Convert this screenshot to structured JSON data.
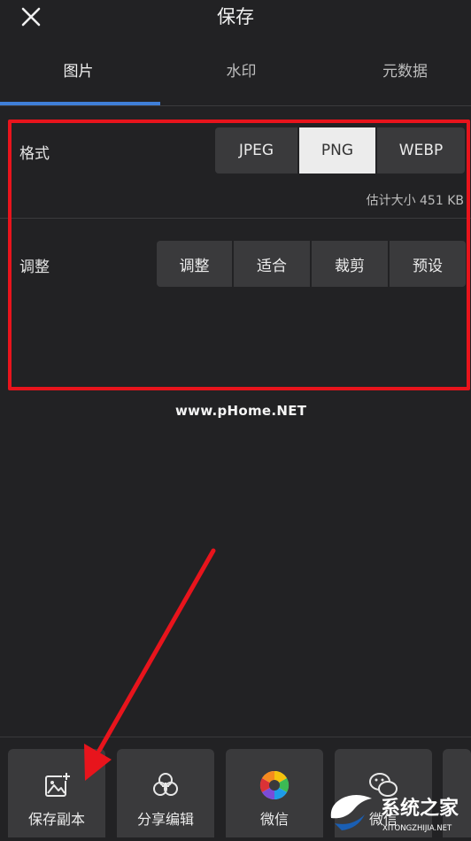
{
  "header": {
    "title": "保存",
    "close_icon": "close-icon"
  },
  "tabs": [
    {
      "label": "图片",
      "active": true
    },
    {
      "label": "水印",
      "active": false
    },
    {
      "label": "元数据",
      "active": false
    }
  ],
  "format": {
    "label": "格式",
    "options": [
      "JPEG",
      "PNG",
      "WEBP"
    ],
    "selected": "PNG",
    "estimate": "估计大小 451 KB"
  },
  "adjust": {
    "label": "调整",
    "options": [
      "调整",
      "适合",
      "裁剪",
      "预设"
    ]
  },
  "watermark_text": "www.pHome.NET",
  "actions": [
    {
      "label": "保存副本",
      "icon": "image-plus-icon"
    },
    {
      "label": "分享编辑",
      "icon": "share-edit-icon"
    },
    {
      "label": "微信",
      "icon": "wechat-moments-icon"
    },
    {
      "label": "微信",
      "icon": "wechat-icon"
    }
  ],
  "logo": {
    "text": "系统之家",
    "subtext": "XITONGZHIJIA.NET"
  },
  "colors": {
    "accent": "#3f7fd8",
    "highlight": "#e8141c",
    "background": "#222224"
  }
}
